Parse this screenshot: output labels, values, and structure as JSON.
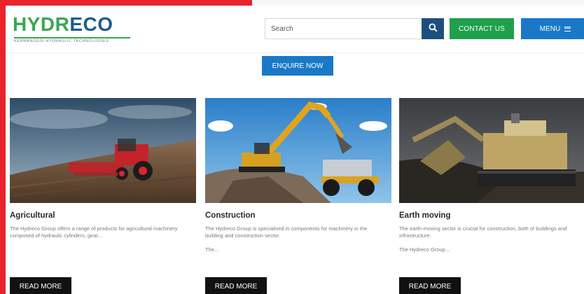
{
  "brand": {
    "logo_word_start": "HYDR",
    "logo_word_end": "ECO",
    "tagline": "KERMANOGSI HYDRAULIC TECHNOLOGIES",
    "colors": {
      "blue": "#1d5c8e",
      "green": "#3aa655",
      "accent_red": "#e8232c"
    }
  },
  "header": {
    "search_placeholder": "Search",
    "search_icon": "search-icon",
    "contact_label": "CONTACT US",
    "menu_label": "MENU",
    "menu_icon": "hamburger-icon"
  },
  "enquire_label": "ENQUIRE NOW",
  "cards": [
    {
      "title": "Agricultural",
      "text": "The Hydreco Group offers a range of products for agricultural machinery composed of hydraulic cylinders, gear...",
      "more": "",
      "button": "READ MORE"
    },
    {
      "title": "Construction",
      "text": "The Hydreco Group is specialised in components for machinery in the building and construction sector.",
      "more": "The...",
      "button": "READ MORE"
    },
    {
      "title": "Earth moving",
      "text": "The earth-moving sector is crucial for construction, both of buildings and infrastructure.",
      "more": "The Hydreco Group...",
      "button": "READ MORE"
    }
  ]
}
